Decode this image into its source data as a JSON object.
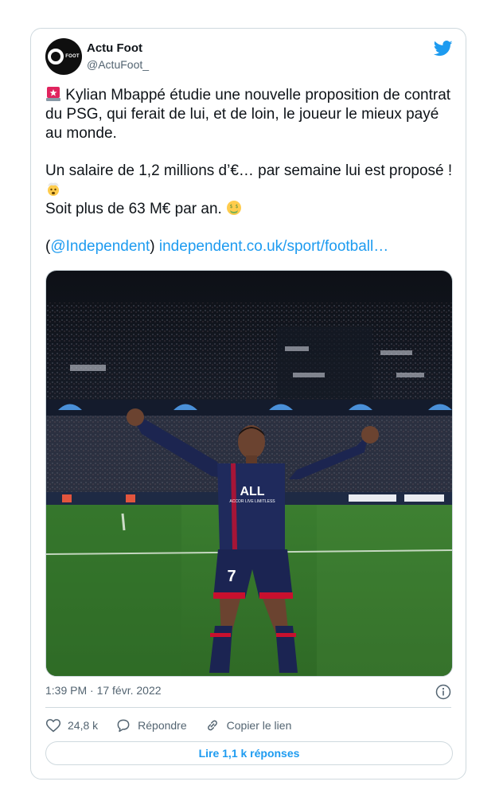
{
  "author": {
    "name": "Actu Foot",
    "handle": "@ActuFoot_",
    "avatar_text": "FOOT"
  },
  "tweet": {
    "line1_text": "Kylian Mbappé étudie une nouvelle proposition de contrat du PSG, qui ferait de lui, et de loin, le joueur le mieux payé au monde.",
    "line2_text": "Un salaire de 1,2 millions d’€… par semaine lui est proposé ! ",
    "line3_text": "Soit plus de 63 M€ par an. ",
    "mention_open": "(",
    "mention": "@Independent",
    "mention_close": ")",
    "url": "independent.co.uk/sport/football…",
    "emoji_icons": [
      "rotating-light-icon",
      "exploding-head-icon",
      "money-mouth-icon"
    ]
  },
  "photo": {
    "jersey_sponsor": "ALL",
    "jersey_subtext": "ACCOR LIVE LIMITLESS",
    "jersey_number": "7"
  },
  "meta": {
    "timestamp": "1:39 PM · 17 févr. 2022"
  },
  "actions": {
    "likes_count": "24,8 k",
    "reply_label": "Répondre",
    "copy_link_label": "Copier le lien"
  },
  "replies_button_label": "Lire 1,1 k réponses",
  "colors": {
    "link": "#1d9bf0",
    "secondary_text": "#536471",
    "border": "#cfd9de",
    "twitter_blue": "#1d9bf0"
  },
  "icons": [
    "twitter-bird-icon",
    "info-icon",
    "heart-icon",
    "comment-icon",
    "link-icon"
  ]
}
